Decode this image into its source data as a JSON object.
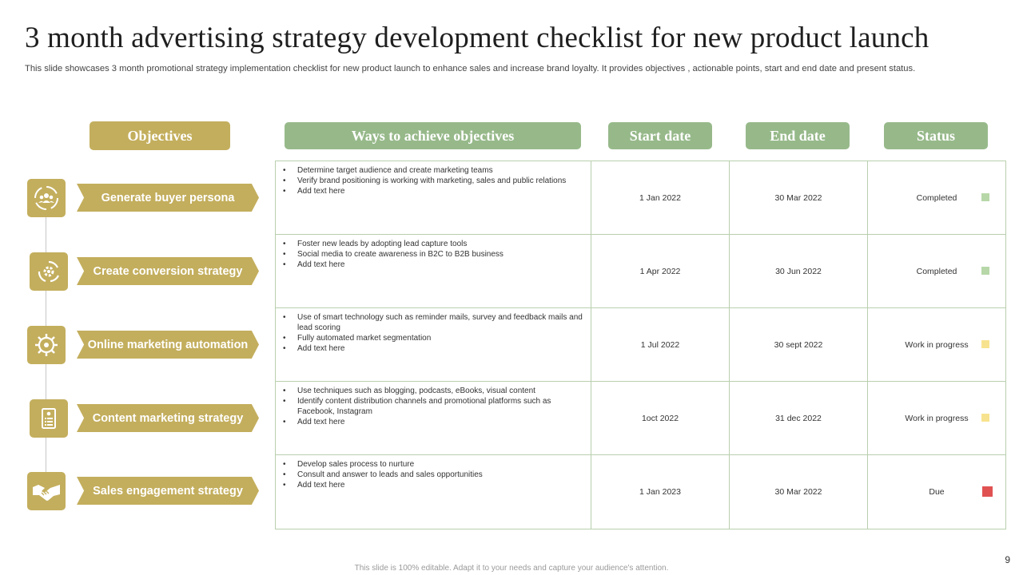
{
  "title": "3 month advertising strategy development checklist for new product launch",
  "subtitle": "This slide showcases 3 month promotional strategy implementation checklist for new product launch to enhance sales and increase brand loyalty. It provides objectives , actionable points, start and end date and present status.",
  "headers": {
    "objectives": "Objectives",
    "ways": "Ways to achieve objectives",
    "start": "Start date",
    "end": "End date",
    "status": "Status"
  },
  "colors": {
    "gold": "#c3ae5d",
    "green": "#97b98a",
    "completed": "#b7d7a8",
    "in_progress": "#f7e38f",
    "due": "#e05252"
  },
  "objectives": [
    {
      "label": "Generate buyer persona",
      "icon": "users-circle-icon"
    },
    {
      "label": "Create conversion strategy",
      "icon": "cycle-gear-icon"
    },
    {
      "label": "Online marketing automation",
      "icon": "automation-gear-icon"
    },
    {
      "label": "Content marketing strategy",
      "icon": "document-list-icon"
    },
    {
      "label": "Sales engagement strategy",
      "icon": "handshake-icon"
    }
  ],
  "rows": [
    {
      "ways": [
        "Determine target audience and create marketing teams",
        "Verify brand positioning is working with marketing, sales and public relations",
        "Add text here"
      ],
      "start": "1 Jan 2022",
      "end": "30 Mar 2022",
      "status": "Completed",
      "status_color": "#b7d7a8"
    },
    {
      "ways": [
        "Foster new leads by adopting lead capture tools",
        "Social media to create awareness in B2C to B2B business",
        "Add text here"
      ],
      "start": "1 Apr 2022",
      "end": "30 Jun 2022",
      "status": "Completed",
      "status_color": "#b7d7a8"
    },
    {
      "ways": [
        "Use of smart technology such as reminder mails, survey and feedback mails and lead scoring",
        "Fully automated market segmentation",
        "Add text here"
      ],
      "start": "1 Jul 2022",
      "end": "30 sept 2022",
      "status": "Work in progress",
      "status_color": "#f7e38f"
    },
    {
      "ways": [
        "Use techniques such as blogging, podcasts, eBooks, visual content",
        "Identify content distribution channels and promotional platforms such as Facebook, Instagram",
        "Add text here"
      ],
      "start": "1oct 2022",
      "end": "31 dec 2022",
      "status": "Work in progress",
      "status_color": "#f7e38f"
    },
    {
      "ways": [
        "Develop sales process to nurture",
        "Consult and answer to leads and sales opportunities",
        "Add text here"
      ],
      "start": "1 Jan 2023",
      "end": "30 Mar 2022",
      "status": "Due",
      "status_color": "#e05252"
    }
  ],
  "page_number": "9",
  "footer": "This slide is 100% editable. Adapt it to your needs and capture your audience's attention."
}
